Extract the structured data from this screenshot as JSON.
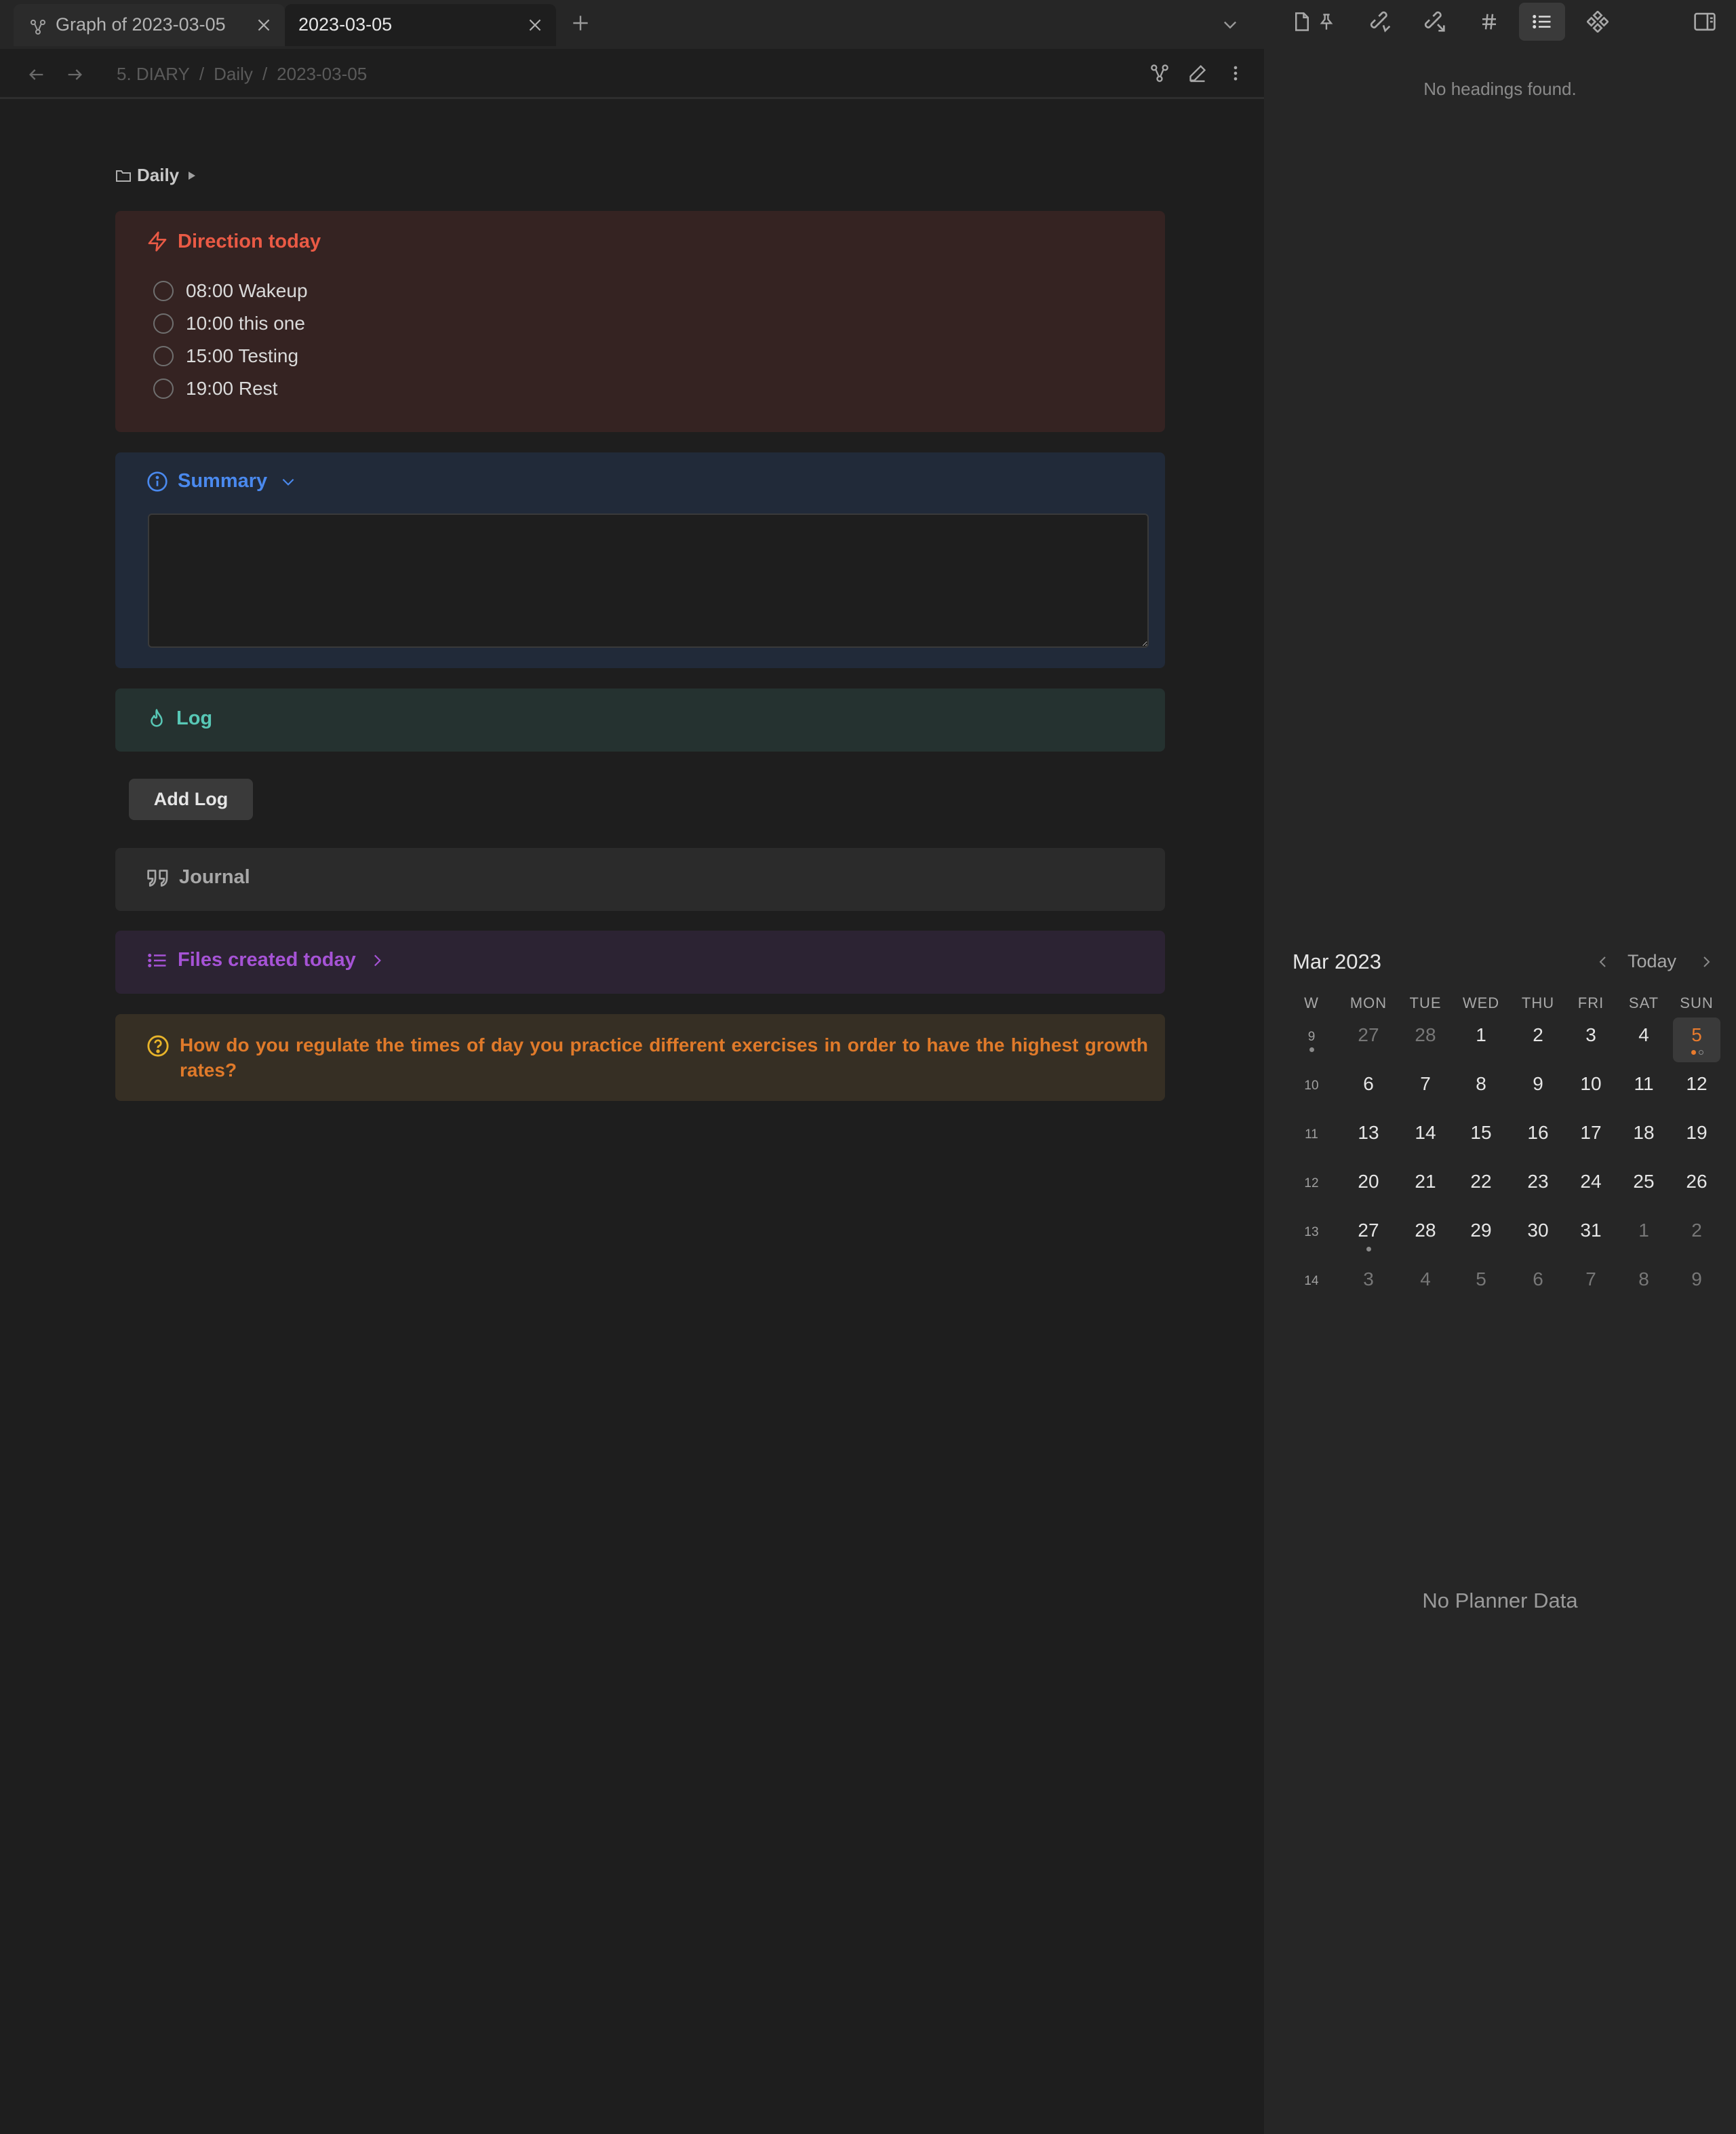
{
  "tabs": [
    {
      "title": "Graph of 2023-03-05",
      "icon": "graph-icon",
      "active": false
    },
    {
      "title": "2023-03-05",
      "active": true
    }
  ],
  "breadcrumb": [
    "5. DIARY",
    "Daily",
    "2023-03-05"
  ],
  "breadcrumb_sep": "/",
  "folder": {
    "label": "Daily"
  },
  "direction": {
    "title": "Direction today",
    "tasks": [
      "08:00 Wakeup",
      "10:00 this one",
      "15:00 Testing",
      "19:00 Rest"
    ]
  },
  "summary": {
    "title": "Summary",
    "text": ""
  },
  "log": {
    "title": "Log"
  },
  "add_log": {
    "label": "Add Log"
  },
  "journal": {
    "title": "Journal"
  },
  "files": {
    "title": "Files created today"
  },
  "question": {
    "text": "How do you regulate the times of day you practice different exercises in order to have the highest growth rates?"
  },
  "outline": {
    "empty_text": "No headings found."
  },
  "calendar": {
    "month_label": "Mar 2023",
    "today_label": "Today",
    "headers": [
      "W",
      "MON",
      "TUE",
      "WED",
      "THU",
      "FRI",
      "SAT",
      "SUN"
    ],
    "weeks": [
      {
        "week": "9",
        "days": [
          "27",
          "28",
          "1",
          "2",
          "3",
          "4",
          "5"
        ]
      },
      {
        "week": "10",
        "days": [
          "6",
          "7",
          "8",
          "9",
          "10",
          "11",
          "12"
        ]
      },
      {
        "week": "11",
        "days": [
          "13",
          "14",
          "15",
          "16",
          "17",
          "18",
          "19"
        ]
      },
      {
        "week": "12",
        "days": [
          "20",
          "21",
          "22",
          "23",
          "24",
          "25",
          "26"
        ]
      },
      {
        "week": "13",
        "days": [
          "27",
          "28",
          "29",
          "30",
          "31",
          "1",
          "2"
        ]
      },
      {
        "week": "14",
        "days": [
          "3",
          "4",
          "5",
          "6",
          "7",
          "8",
          "9"
        ]
      }
    ],
    "today": "5"
  },
  "planner": {
    "empty_text": "No Planner Data"
  },
  "colors": {
    "direction": "#ea5a45",
    "summary": "#4a89ee",
    "log": "#58c8b6",
    "files": "#a653d6",
    "question": "#e07a2a",
    "question_icon": "#e8b42a",
    "today": "#e87b2d"
  }
}
